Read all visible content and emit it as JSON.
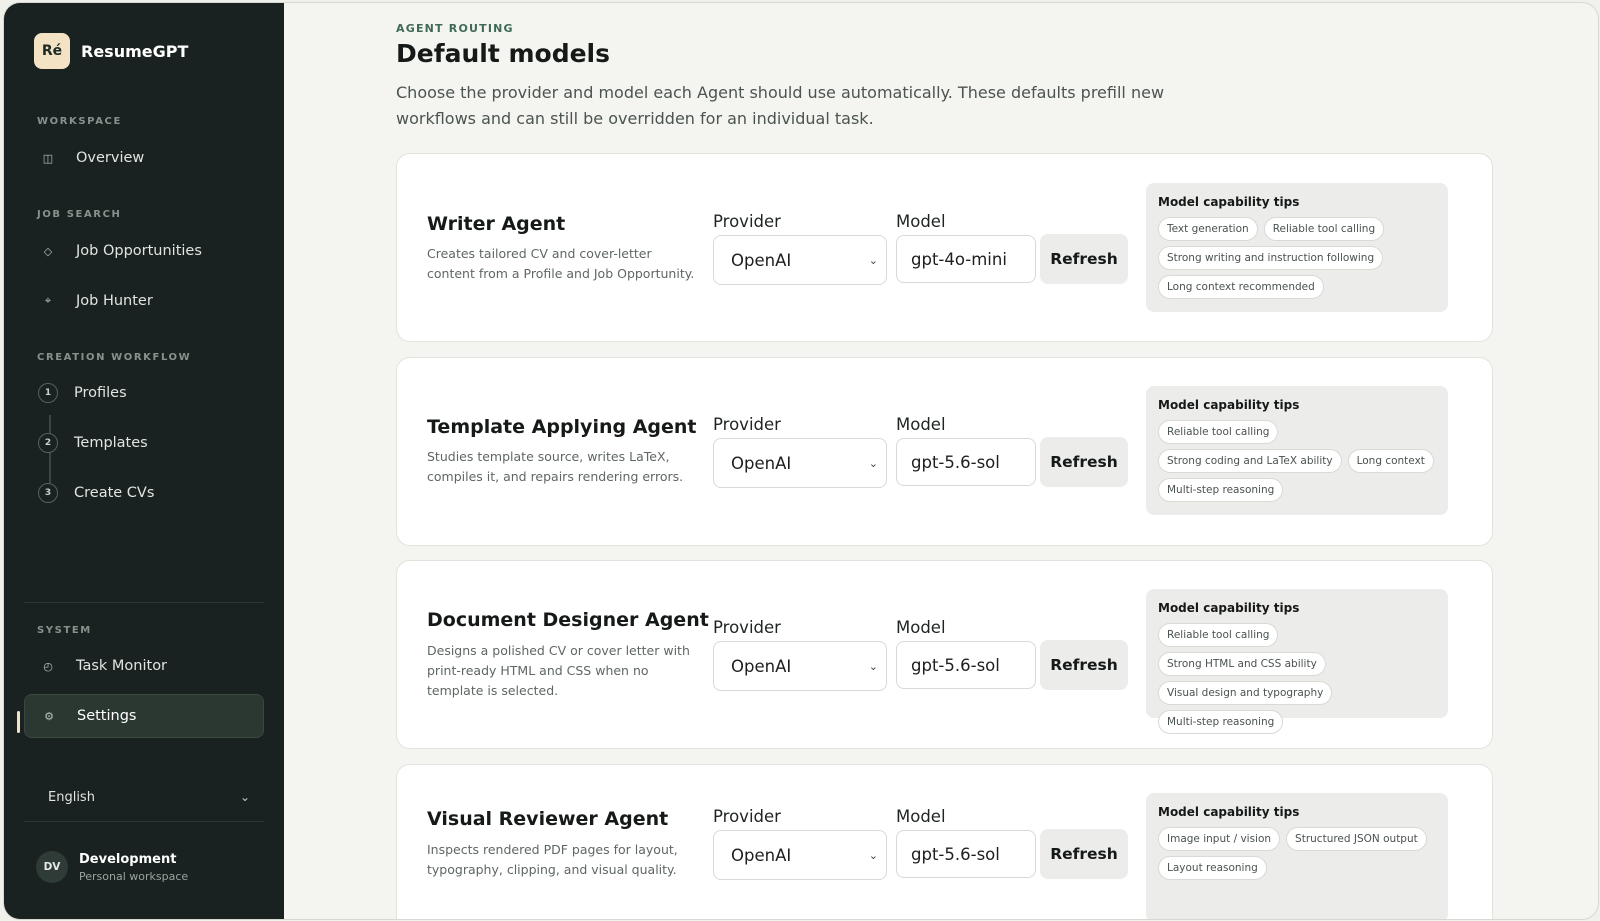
{
  "app": {
    "logo_text": "Ré",
    "name": "ResumeGPT"
  },
  "sidebar": {
    "sections": {
      "workspace": "WORKSPACE",
      "job_search": "JOB SEARCH",
      "creation": "CREATION WORKFLOW",
      "system": "SYSTEM"
    },
    "items": {
      "overview": {
        "label": "Overview",
        "icon": "layout-icon"
      },
      "job_opportunities": {
        "label": "Job Opportunities",
        "icon": "diamond-icon"
      },
      "job_hunter": {
        "label": "Job Hunter",
        "icon": "crosshair-icon"
      },
      "profiles": {
        "label": "Profiles",
        "step": "1"
      },
      "templates": {
        "label": "Templates",
        "step": "2"
      },
      "create_cvs": {
        "label": "Create CVs",
        "step": "3"
      },
      "task_monitor": {
        "label": "Task Monitor",
        "icon": "clock-icon"
      },
      "settings": {
        "label": "Settings",
        "icon": "gear-icon",
        "active": true
      }
    },
    "language": "English",
    "user": {
      "initials": "DV",
      "name": "Development",
      "subtitle": "Personal workspace"
    }
  },
  "main": {
    "eyebrow": "AGENT ROUTING",
    "title": "Default models",
    "description": "Choose the provider and model each Agent should use automatically. These defaults prefill new workflows and can still be overridden for an individual task.",
    "provider_label": "Provider",
    "model_label": "Model",
    "refresh_label": "Refresh",
    "tips_title": "Model capability tips",
    "agents": [
      {
        "name": "Writer Agent",
        "description": "Creates tailored CV and cover-letter content from a Profile and Job Opportunity.",
        "provider": "OpenAI",
        "model": "gpt-4o-mini",
        "tips": [
          "Text generation",
          "Reliable tool calling",
          "Strong writing and instruction following",
          "Long context recommended"
        ]
      },
      {
        "name": "Template Applying Agent",
        "description": "Studies template source, writes LaTeX, compiles it, and repairs rendering errors.",
        "provider": "OpenAI",
        "model": "gpt-5.6-sol",
        "tips": [
          "Reliable tool calling",
          "Strong coding and LaTeX ability",
          "Long context",
          "Multi-step reasoning"
        ]
      },
      {
        "name": "Document Designer Agent",
        "description": "Designs a polished CV or cover letter with print-ready HTML and CSS when no template is selected.",
        "provider": "OpenAI",
        "model": "gpt-5.6-sol",
        "tips": [
          "Reliable tool calling",
          "Strong HTML and CSS ability",
          "Visual design and typography",
          "Multi-step reasoning"
        ]
      },
      {
        "name": "Visual Reviewer Agent",
        "description": "Inspects rendered PDF pages for layout, typography, clipping, and visual quality.",
        "provider": "OpenAI",
        "model": "gpt-5.6-sol",
        "tips": [
          "Image input / vision",
          "Structured JSON output",
          "Layout reasoning"
        ]
      }
    ]
  },
  "colors": {
    "sidebar_bg": "#192220",
    "accent_logo": "#f3e2c4",
    "eyebrow": "#3f6a55",
    "page_bg": "#f4f4f0"
  }
}
